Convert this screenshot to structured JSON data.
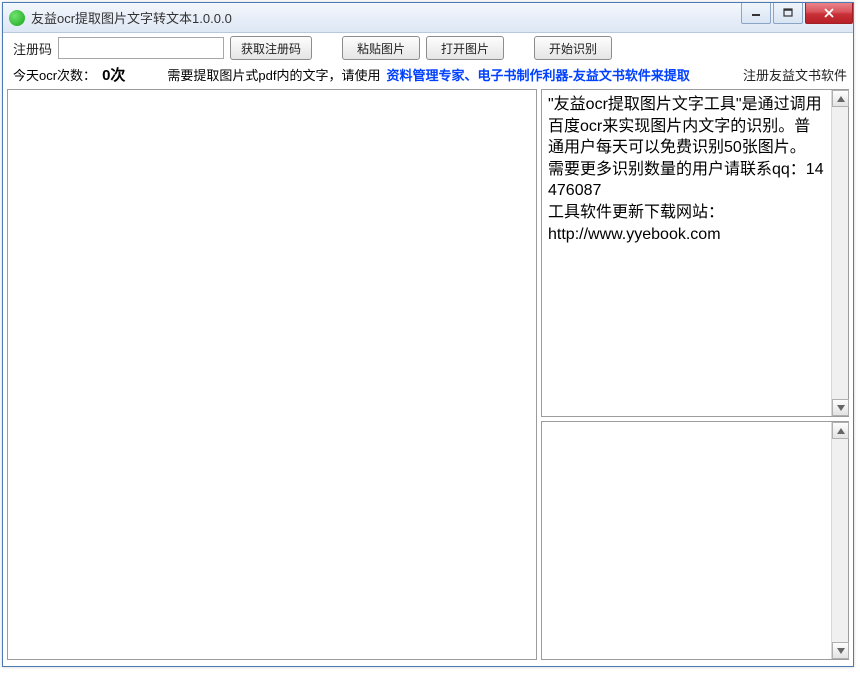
{
  "window": {
    "title": "友益ocr提取图片文字转文本1.0.0.0"
  },
  "toolbar": {
    "reg_label": "注册码",
    "reg_value": "",
    "get_code_btn": "获取注册码",
    "paste_img_btn": "粘贴图片",
    "open_img_btn": "打开图片",
    "start_ocr_btn": "开始识别"
  },
  "status": {
    "today_label": "今天ocr次数：",
    "count": "0次",
    "hint": "需要提取图片式pdf内的文字，请使用",
    "link_text": "资料管理专家、电子书制作利器-友益文书软件来提取",
    "register_link": "注册友益文书软件"
  },
  "panels": {
    "info_text": "\"友益ocr提取图片文字工具\"是通过调用百度ocr来实现图片内文字的识别。普通用户每天可以免费识别50张图片。\n需要更多识别数量的用户请联系qq：14476087\n工具软件更新下载网站：\nhttp://www.yyebook.com",
    "output_text": ""
  }
}
